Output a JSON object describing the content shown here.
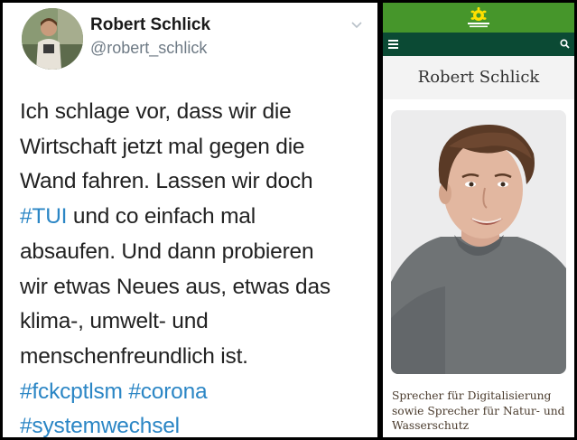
{
  "tweet": {
    "name": "Robert Schlick",
    "handle": "@robert_schlick",
    "lines": [
      [
        {
          "t": "Ich schlage vor, dass wir die"
        }
      ],
      [
        {
          "t": "Wirtschaft jetzt mal gegen die"
        }
      ],
      [
        {
          "t": "Wand fahren. Lassen wir doch"
        }
      ],
      [
        {
          "t": "#TUI",
          "h": true
        },
        {
          "t": " und co einfach mal"
        }
      ],
      [
        {
          "t": "absaufen. Und dann probieren"
        }
      ],
      [
        {
          "t": "wir etwas Neues aus, etwas das"
        }
      ],
      [
        {
          "t": "klima-, umwelt- und"
        }
      ],
      [
        {
          "t": "menschenfreundlich ist."
        }
      ],
      [
        {
          "t": "#fckcptlsm #corona",
          "h": true
        }
      ],
      [
        {
          "t": "#systemwechsel",
          "h": true
        }
      ]
    ]
  },
  "site": {
    "title": "Robert Schlick",
    "caption_lines": [
      "Sprecher für Digitalisierung",
      "sowie Sprecher für Natur- und",
      "Wasserschutz"
    ],
    "colors": {
      "brand_green": "#46962b",
      "nav_dark": "#0b4a34",
      "hashtag": "#2b86c5"
    }
  }
}
